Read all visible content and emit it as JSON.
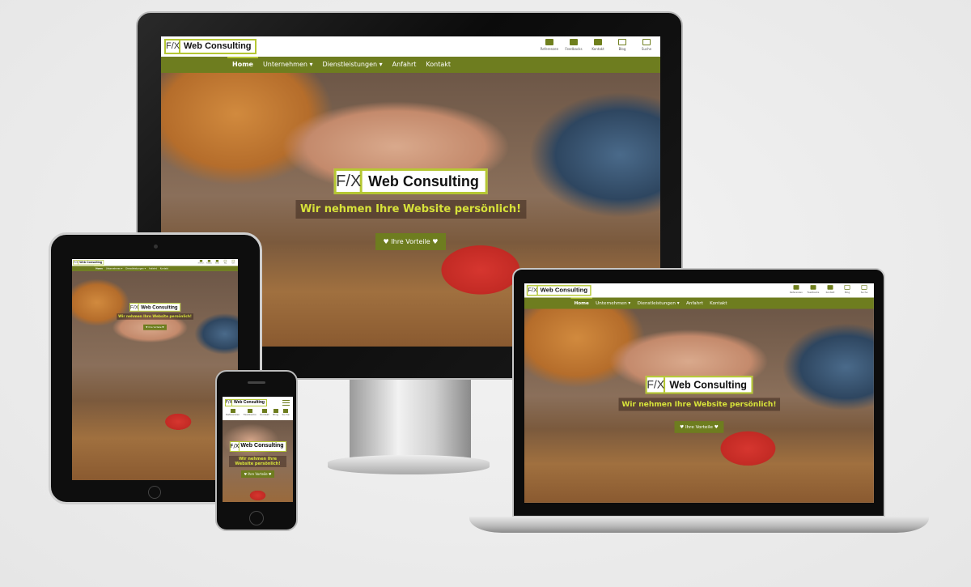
{
  "site": {
    "logo_mark": "F/X",
    "logo_name": "Web Consulting",
    "header_icons": [
      {
        "icon": "monitor-icon",
        "label": "Referenzen"
      },
      {
        "icon": "speech-bubble-icon",
        "label": "Feedbacks"
      },
      {
        "icon": "contact-card-icon",
        "label": "Kontakt"
      },
      {
        "icon": "cast-icon",
        "label": "Blog"
      },
      {
        "icon": "search-icon",
        "label": "Suche"
      }
    ],
    "nav": [
      {
        "label": "Home",
        "active": true
      },
      {
        "label": "Unternehmen ▾"
      },
      {
        "label": "Dienstleistungen ▾"
      },
      {
        "label": "Anfahrt"
      },
      {
        "label": "Kontakt"
      }
    ],
    "slogan": "Wir nehmen Ihre Website persönlich!",
    "cta": "♥ Ihre Vorteile ♥"
  },
  "colors": {
    "accent": "#6e7d1f",
    "logo_border": "#b5c733",
    "slogan": "#d7e23a"
  }
}
